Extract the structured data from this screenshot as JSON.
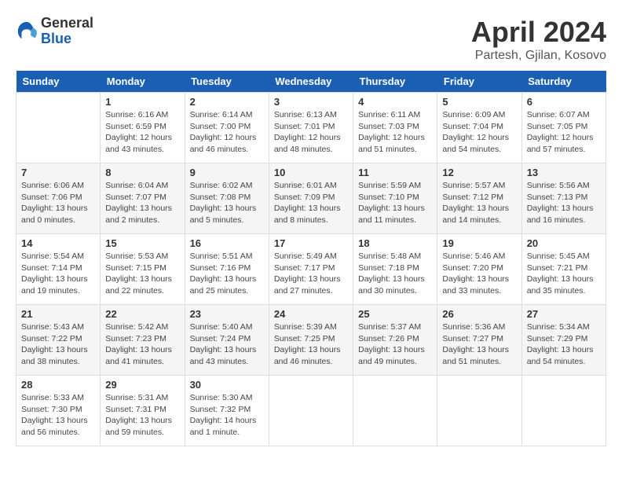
{
  "header": {
    "logo_general": "General",
    "logo_blue": "Blue",
    "month_title": "April 2024",
    "location": "Partesh, Gjilan, Kosovo"
  },
  "days_of_week": [
    "Sunday",
    "Monday",
    "Tuesday",
    "Wednesday",
    "Thursday",
    "Friday",
    "Saturday"
  ],
  "weeks": [
    [
      {
        "day": "",
        "info": ""
      },
      {
        "day": "1",
        "info": "Sunrise: 6:16 AM\nSunset: 6:59 PM\nDaylight: 12 hours\nand 43 minutes."
      },
      {
        "day": "2",
        "info": "Sunrise: 6:14 AM\nSunset: 7:00 PM\nDaylight: 12 hours\nand 46 minutes."
      },
      {
        "day": "3",
        "info": "Sunrise: 6:13 AM\nSunset: 7:01 PM\nDaylight: 12 hours\nand 48 minutes."
      },
      {
        "day": "4",
        "info": "Sunrise: 6:11 AM\nSunset: 7:03 PM\nDaylight: 12 hours\nand 51 minutes."
      },
      {
        "day": "5",
        "info": "Sunrise: 6:09 AM\nSunset: 7:04 PM\nDaylight: 12 hours\nand 54 minutes."
      },
      {
        "day": "6",
        "info": "Sunrise: 6:07 AM\nSunset: 7:05 PM\nDaylight: 12 hours\nand 57 minutes."
      }
    ],
    [
      {
        "day": "7",
        "info": "Sunrise: 6:06 AM\nSunset: 7:06 PM\nDaylight: 13 hours\nand 0 minutes."
      },
      {
        "day": "8",
        "info": "Sunrise: 6:04 AM\nSunset: 7:07 PM\nDaylight: 13 hours\nand 2 minutes."
      },
      {
        "day": "9",
        "info": "Sunrise: 6:02 AM\nSunset: 7:08 PM\nDaylight: 13 hours\nand 5 minutes."
      },
      {
        "day": "10",
        "info": "Sunrise: 6:01 AM\nSunset: 7:09 PM\nDaylight: 13 hours\nand 8 minutes."
      },
      {
        "day": "11",
        "info": "Sunrise: 5:59 AM\nSunset: 7:10 PM\nDaylight: 13 hours\nand 11 minutes."
      },
      {
        "day": "12",
        "info": "Sunrise: 5:57 AM\nSunset: 7:12 PM\nDaylight: 13 hours\nand 14 minutes."
      },
      {
        "day": "13",
        "info": "Sunrise: 5:56 AM\nSunset: 7:13 PM\nDaylight: 13 hours\nand 16 minutes."
      }
    ],
    [
      {
        "day": "14",
        "info": "Sunrise: 5:54 AM\nSunset: 7:14 PM\nDaylight: 13 hours\nand 19 minutes."
      },
      {
        "day": "15",
        "info": "Sunrise: 5:53 AM\nSunset: 7:15 PM\nDaylight: 13 hours\nand 22 minutes."
      },
      {
        "day": "16",
        "info": "Sunrise: 5:51 AM\nSunset: 7:16 PM\nDaylight: 13 hours\nand 25 minutes."
      },
      {
        "day": "17",
        "info": "Sunrise: 5:49 AM\nSunset: 7:17 PM\nDaylight: 13 hours\nand 27 minutes."
      },
      {
        "day": "18",
        "info": "Sunrise: 5:48 AM\nSunset: 7:18 PM\nDaylight: 13 hours\nand 30 minutes."
      },
      {
        "day": "19",
        "info": "Sunrise: 5:46 AM\nSunset: 7:20 PM\nDaylight: 13 hours\nand 33 minutes."
      },
      {
        "day": "20",
        "info": "Sunrise: 5:45 AM\nSunset: 7:21 PM\nDaylight: 13 hours\nand 35 minutes."
      }
    ],
    [
      {
        "day": "21",
        "info": "Sunrise: 5:43 AM\nSunset: 7:22 PM\nDaylight: 13 hours\nand 38 minutes."
      },
      {
        "day": "22",
        "info": "Sunrise: 5:42 AM\nSunset: 7:23 PM\nDaylight: 13 hours\nand 41 minutes."
      },
      {
        "day": "23",
        "info": "Sunrise: 5:40 AM\nSunset: 7:24 PM\nDaylight: 13 hours\nand 43 minutes."
      },
      {
        "day": "24",
        "info": "Sunrise: 5:39 AM\nSunset: 7:25 PM\nDaylight: 13 hours\nand 46 minutes."
      },
      {
        "day": "25",
        "info": "Sunrise: 5:37 AM\nSunset: 7:26 PM\nDaylight: 13 hours\nand 49 minutes."
      },
      {
        "day": "26",
        "info": "Sunrise: 5:36 AM\nSunset: 7:27 PM\nDaylight: 13 hours\nand 51 minutes."
      },
      {
        "day": "27",
        "info": "Sunrise: 5:34 AM\nSunset: 7:29 PM\nDaylight: 13 hours\nand 54 minutes."
      }
    ],
    [
      {
        "day": "28",
        "info": "Sunrise: 5:33 AM\nSunset: 7:30 PM\nDaylight: 13 hours\nand 56 minutes."
      },
      {
        "day": "29",
        "info": "Sunrise: 5:31 AM\nSunset: 7:31 PM\nDaylight: 13 hours\nand 59 minutes."
      },
      {
        "day": "30",
        "info": "Sunrise: 5:30 AM\nSunset: 7:32 PM\nDaylight: 14 hours\nand 1 minute."
      },
      {
        "day": "",
        "info": ""
      },
      {
        "day": "",
        "info": ""
      },
      {
        "day": "",
        "info": ""
      },
      {
        "day": "",
        "info": ""
      }
    ]
  ]
}
